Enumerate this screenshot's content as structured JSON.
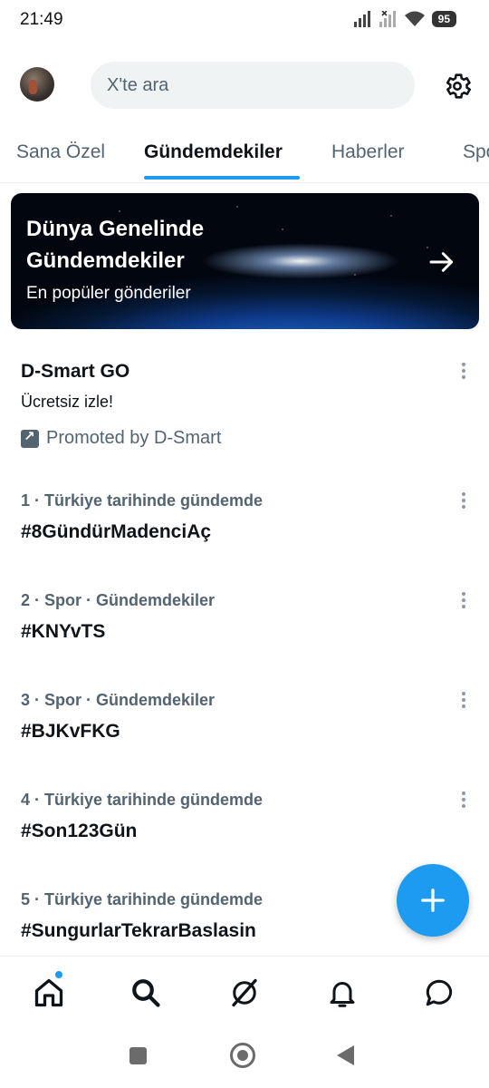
{
  "status_bar": {
    "time": "21:49",
    "battery": "95"
  },
  "search": {
    "placeholder": "X'te ara"
  },
  "tabs": [
    {
      "label": "Sana Özel",
      "active": false
    },
    {
      "label": "Gündemdekiler",
      "active": true
    },
    {
      "label": "Haberler",
      "active": false
    },
    {
      "label": "Spor",
      "active": false
    }
  ],
  "banner": {
    "title": "Dünya Genelinde Gündemdekiler",
    "subtitle": "En popüler gönderiler"
  },
  "promo": {
    "title": "D-Smart GO",
    "description": "Ücretsiz izle!",
    "promoted_by": "Promoted by D-Smart"
  },
  "trends": [
    {
      "meta": "1 · Türkiye tarihinde gündemde",
      "name": "#8GündürMadenciAç"
    },
    {
      "meta": "2 · Spor · Gündemdekiler",
      "name": "#KNYvTS"
    },
    {
      "meta": "3 · Spor · Gündemdekiler",
      "name": "#BJKvFKG"
    },
    {
      "meta": "4 · Türkiye tarihinde gündemde",
      "name": "#Son123Gün"
    },
    {
      "meta": "5 · Türkiye tarihinde gündemde",
      "name": "#SungurlarTekrarBaslasin"
    }
  ],
  "colors": {
    "accent": "#1d9bf0",
    "text": "#0f1419",
    "secondary": "#536471"
  },
  "bottom_nav": [
    "home-icon",
    "search-icon",
    "grok-icon",
    "bell-icon",
    "message-icon"
  ]
}
